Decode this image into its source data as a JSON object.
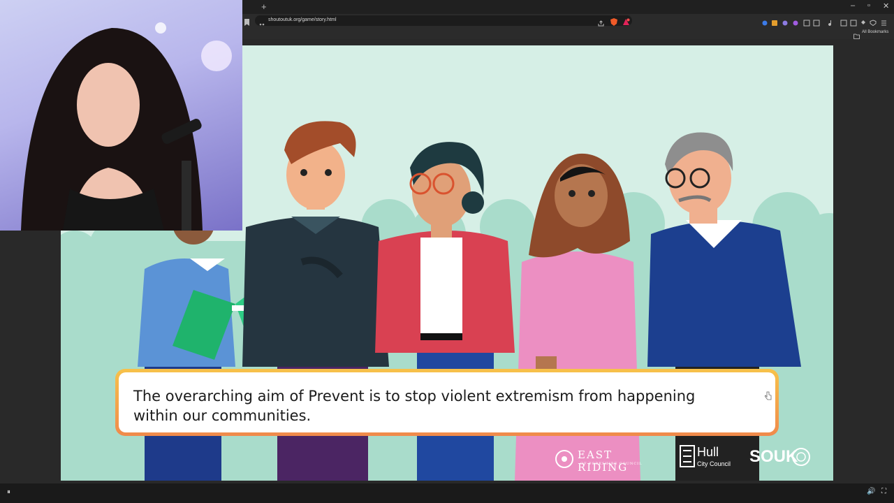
{
  "browser": {
    "new_tab_glyph": "+",
    "url": "shoutoutuk.org/game/story.html",
    "bookmarks_label": "All Bookmarks",
    "window_controls": [
      "–",
      "▫",
      "✕"
    ]
  },
  "game": {
    "dialog_text": "The overarching aim of Prevent is to stop violent extremism from happening within our communities.",
    "logos": {
      "east_riding_main": "EAST RIDING",
      "east_riding_sub": "OF YORKSHIRE COUNCIL",
      "hull_main": "Hull",
      "hull_sub": "City Council",
      "souk": "SOUK"
    }
  },
  "player": {
    "pause_glyph": "⏸",
    "volume_glyph": "🔊",
    "fullscreen_glyph": "⛶"
  },
  "colors": {
    "stage_bg": "#d6efe6",
    "dialog_border": "#f4a847"
  }
}
